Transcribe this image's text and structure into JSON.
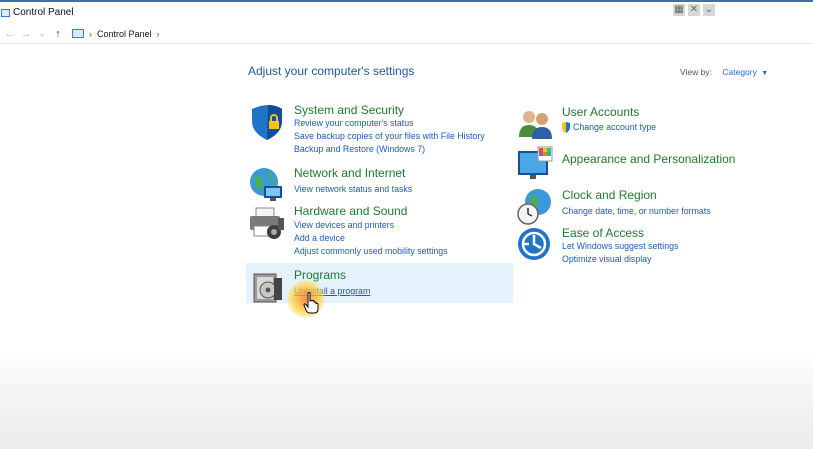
{
  "window": {
    "title": "Control Panel"
  },
  "address": {
    "crumbs": [
      "Control Panel"
    ]
  },
  "main": {
    "heading": "Adjust your computer's settings",
    "view_by_label": "View by:",
    "view_by_value": "Category"
  },
  "categories": {
    "system": {
      "name": "System and Security",
      "links": [
        "Review your computer's status",
        "Save backup copies of your files with File History",
        "Backup and Restore (Windows 7)"
      ]
    },
    "network": {
      "name": "Network and Internet",
      "links": [
        "View network status and tasks"
      ]
    },
    "hardware": {
      "name": "Hardware and Sound",
      "links": [
        "View devices and printers",
        "Add a device",
        "Adjust commonly used mobility settings"
      ]
    },
    "programs": {
      "name": "Programs",
      "links": [
        "Uninstall a program"
      ]
    },
    "users": {
      "name": "User Accounts",
      "links": [
        "Change account type"
      ]
    },
    "appearance": {
      "name": "Appearance and Personalization",
      "links": []
    },
    "clock": {
      "name": "Clock and Region",
      "links": [
        "Change date, time, or number formats"
      ]
    },
    "ease": {
      "name": "Ease of Access",
      "links": [
        "Let Windows suggest settings",
        "Optimize visual display"
      ]
    }
  },
  "colors": {
    "heading": "#1e5aa8",
    "category": "#1e7b2c",
    "link": "#1c5cc4",
    "highlight": "#e5f1fb"
  }
}
